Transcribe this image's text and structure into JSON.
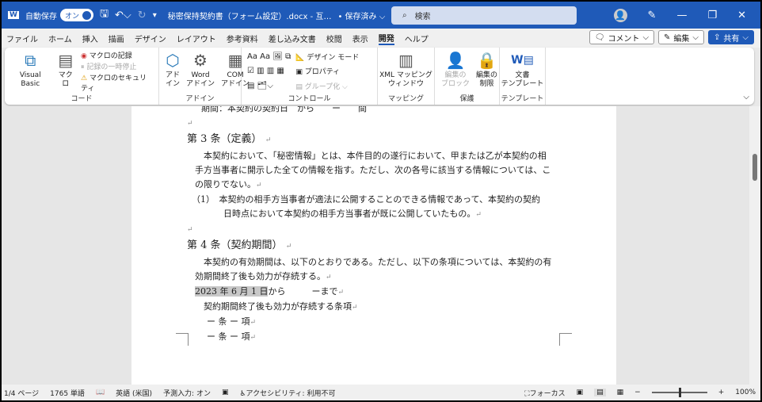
{
  "titlebar": {
    "autosave_label": "自動保存",
    "autosave_state": "オン",
    "doc_title": "秘密保持契約書（フォーム設定）.docx - 互…",
    "save_status": "• 保存済み ⌵",
    "search_placeholder": "検索"
  },
  "tabs": [
    "ファイル",
    "ホーム",
    "挿入",
    "描画",
    "デザイン",
    "レイアウト",
    "参考資料",
    "差し込み文書",
    "校閲",
    "表示",
    "開発",
    "ヘルプ"
  ],
  "active_tab": "開発",
  "actions": {
    "comment": "コメント",
    "edit": "編集",
    "share": "共有"
  },
  "ribbon": {
    "code": {
      "label": "コード",
      "visual_basic": "Visual Basic",
      "macro": "マクロ",
      "record": "マクロの記録",
      "pause": "記録の一時停止",
      "security": "マクロのセキュリティ"
    },
    "addin": {
      "label": "アドイン",
      "addin": "アド\nイン",
      "word_addin": "Word\nアドイン",
      "com_addin": "COM\nアドイン"
    },
    "controls": {
      "label": "コントロール",
      "design_mode": "デザイン モード",
      "properties": "プロパティ",
      "group": "グループ化"
    },
    "mapping": {
      "label": "マッピング",
      "xml": "XML マッピング\nウィンドウ"
    },
    "protect": {
      "label": "保護",
      "block": "編集の\nブロック",
      "restrict": "編集の\n制限"
    },
    "template": {
      "label": "テンプレート",
      "doc_template": "文書\nテンプレート"
    }
  },
  "document": {
    "line0": "期間：本契約の契約日　から　　ー　　間",
    "art3_title": "第 3 条（定義）",
    "art3_p1": [
      "　本契約において、「秘密情報」とは、本件目的の遂行において、甲または乙が本契約の相",
      "手方当事者に開示した全ての情報を指す。ただし、次の各号に該当する情報については、こ",
      "の限りでない。"
    ],
    "art3_item1": [
      "（1）　本契約の相手方当事者が適法に公開することのできる情報であって、本契約の契約",
      "日時点において本契約の相手方当事者が既に公開していたもの。"
    ],
    "art4_title": "第 4 条（契約期間）",
    "art4_p1": [
      "　本契約の有効期間は、以下のとおりである。ただし、以下の条項については、本契約の有",
      "効期間終了後も効力が存続する。"
    ],
    "period_date": "2023 年 6 月 1 日",
    "period_rest": "から　　　ーまで",
    "survive": "　契約期間終了後も効力が存続する条項",
    "clause1": "　ー 条 ー 項",
    "clause2": "　ー 条 ー 項",
    "mark": "↵"
  },
  "status": {
    "page": "1/4 ページ",
    "words": "1765 単語",
    "lang": "英語 (米国)",
    "predict": "予測入力: オン",
    "access": "アクセシビリティ: 利用不可",
    "focus": "フォーカス",
    "zoom": "100%"
  },
  "colors": {
    "accent": "#1f5ab8"
  }
}
